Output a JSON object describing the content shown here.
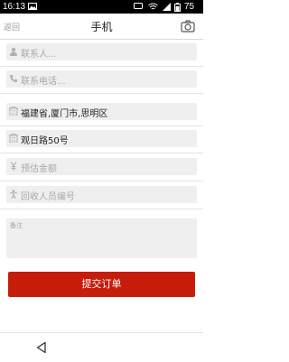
{
  "status_bar": {
    "time": "16:13",
    "battery": "75"
  },
  "header": {
    "back_label": "返回",
    "title": "手机"
  },
  "form": {
    "contact_name": {
      "placeholder": "联系人...",
      "value": ""
    },
    "contact_phone": {
      "placeholder": "联系电话...",
      "value": ""
    },
    "region": {
      "placeholder": "",
      "value": "福建省,厦门市,思明区"
    },
    "street_address": {
      "placeholder": "",
      "value": "观日路50号"
    },
    "estimated_amount": {
      "placeholder": "预估金额",
      "value": ""
    },
    "recycler_id": {
      "placeholder": "回收人员编号",
      "value": ""
    },
    "remarks": {
      "placeholder": "备注",
      "value": ""
    }
  },
  "submit_label": "提交订单",
  "icons": {
    "status": [
      "image-icon",
      "message-icon",
      "wifi-icon",
      "signal-icon",
      "battery-icon"
    ],
    "header": [
      "camera-icon"
    ],
    "fields": [
      "person-icon",
      "phone-icon",
      "building-icon",
      "building-icon",
      "currency-icon",
      "person-arms-icon"
    ],
    "nav": [
      "back-triangle-icon"
    ]
  },
  "colors": {
    "submit_button": "#c61d0b",
    "input_background": "#efefef",
    "status_bar": "#000000"
  }
}
